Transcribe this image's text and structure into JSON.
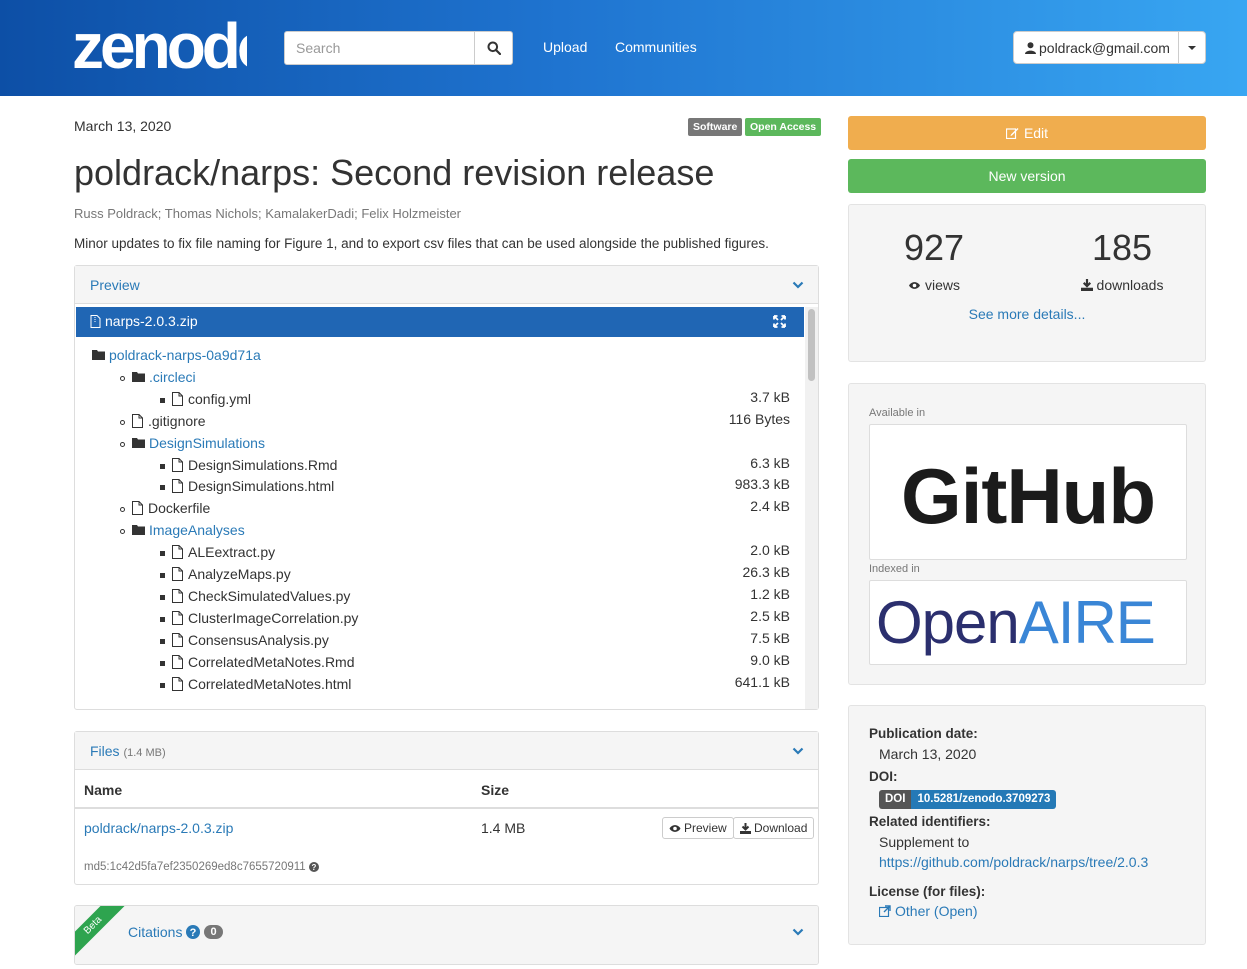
{
  "header": {
    "logo_text": "zenodo",
    "search_placeholder": "Search",
    "nav": [
      "Upload",
      "Communities"
    ],
    "user_email": "poldrack@gmail.com"
  },
  "record": {
    "date": "March 13, 2020",
    "badges": [
      "Software",
      "Open Access"
    ],
    "title": "poldrack/narps: Second revision release",
    "creators": "Russ Poldrack; Thomas Nichols; KamalakerDadi; Felix Holzmeister",
    "description": "Minor updates to fix file naming for Figure 1, and to export csv files that can be used alongside the published figures."
  },
  "preview": {
    "heading": "Preview",
    "filename": "narps-2.0.3.zip",
    "tree": [
      {
        "name": "poldrack-narps-0a9d71a",
        "type": "folder",
        "level": 0,
        "size": ""
      },
      {
        "name": ".circleci",
        "type": "folder",
        "level": 1,
        "size": ""
      },
      {
        "name": "config.yml",
        "type": "file",
        "level": 2,
        "size": "3.7 kB"
      },
      {
        "name": ".gitignore",
        "type": "file",
        "level": 1,
        "size": "116 Bytes"
      },
      {
        "name": "DesignSimulations",
        "type": "folder",
        "level": 1,
        "size": ""
      },
      {
        "name": "DesignSimulations.Rmd",
        "type": "file",
        "level": 2,
        "size": "6.3 kB"
      },
      {
        "name": "DesignSimulations.html",
        "type": "file",
        "level": 2,
        "size": "983.3 kB"
      },
      {
        "name": "Dockerfile",
        "type": "file",
        "level": 1,
        "size": "2.4 kB"
      },
      {
        "name": "ImageAnalyses",
        "type": "folder",
        "level": 1,
        "size": ""
      },
      {
        "name": "ALEextract.py",
        "type": "file",
        "level": 2,
        "size": "2.0 kB"
      },
      {
        "name": "AnalyzeMaps.py",
        "type": "file",
        "level": 2,
        "size": "26.3 kB"
      },
      {
        "name": "CheckSimulatedValues.py",
        "type": "file",
        "level": 2,
        "size": "1.2 kB"
      },
      {
        "name": "ClusterImageCorrelation.py",
        "type": "file",
        "level": 2,
        "size": "2.5 kB"
      },
      {
        "name": "ConsensusAnalysis.py",
        "type": "file",
        "level": 2,
        "size": "7.5 kB"
      },
      {
        "name": "CorrelatedMetaNotes.Rmd",
        "type": "file",
        "level": 2,
        "size": "9.0 kB"
      },
      {
        "name": "CorrelatedMetaNotes.html",
        "type": "file",
        "level": 2,
        "size": "641.1 kB"
      }
    ]
  },
  "files": {
    "heading": "Files",
    "total_size": "(1.4 MB)",
    "col_name": "Name",
    "col_size": "Size",
    "file_name": "poldrack/narps-2.0.3.zip",
    "file_size": "1.4 MB",
    "md5": "md5:1c42d5fa7ef2350269ed8c7655720911",
    "preview_btn": "Preview",
    "download_btn": "Download"
  },
  "citations": {
    "ribbon": "Beta",
    "heading": "Citations",
    "count": "0"
  },
  "sidebar": {
    "edit_label": "Edit",
    "new_version_label": "New version",
    "views": "927",
    "views_label": "views",
    "downloads": "185",
    "downloads_label": "downloads",
    "see_more": "See more details...",
    "available_in": "Available in",
    "github_logo_text": "GitHub",
    "indexed_in": "Indexed in",
    "openaire_logo_text": "OpenAIRE",
    "pub_date_label": "Publication date:",
    "pub_date": "March 13, 2020",
    "doi_label": "DOI:",
    "doi_prefix": "DOI",
    "doi": "10.5281/zenodo.3709273",
    "related_label": "Related identifiers:",
    "related_type": "Supplement to",
    "related_link": "https://github.com/poldrack/narps/tree/2.0.3",
    "license_label": "License (for files):",
    "license": "Other (Open)"
  },
  "colors": {
    "header_start": "#0d4fa6",
    "header_end": "#38a6f2",
    "edit_btn": "#f0ad4e",
    "new_version_btn": "#5cb85c",
    "software_badge": "#777777",
    "open_access_badge": "#5cb85c",
    "preview_bar": "#2066b4",
    "link": "#2a7ab7"
  }
}
